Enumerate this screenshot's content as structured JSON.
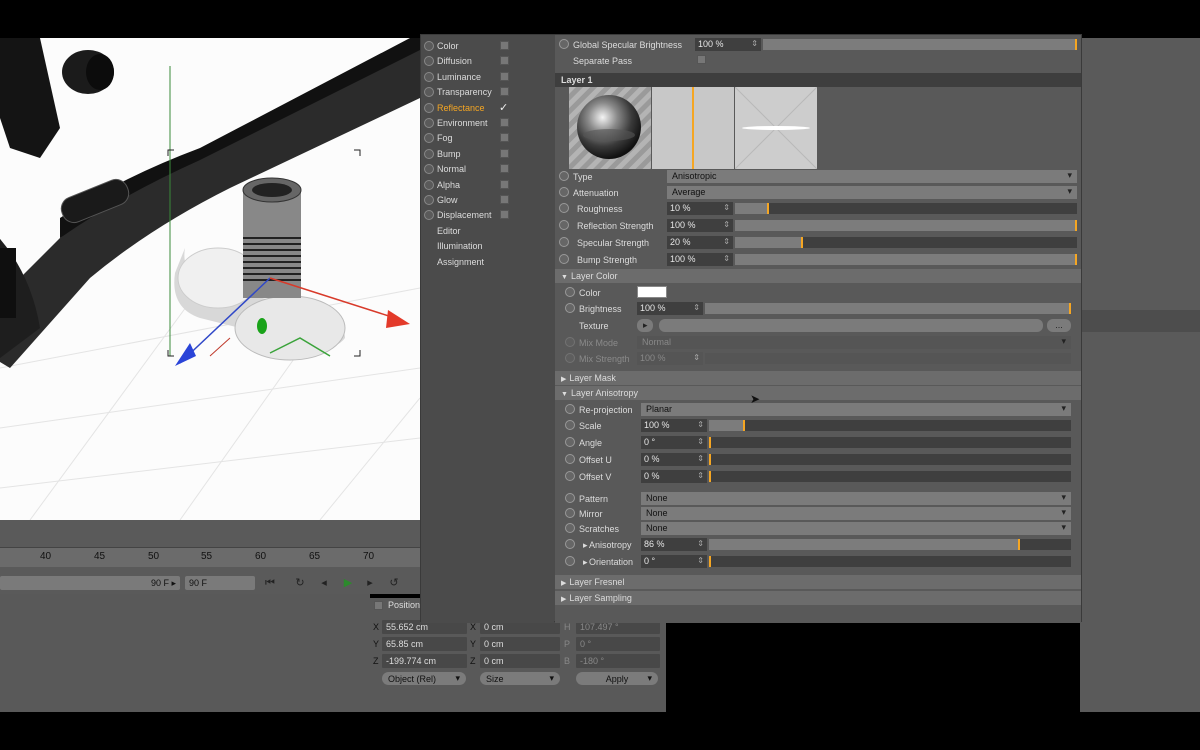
{
  "channels": [
    {
      "label": "Color",
      "checked": false
    },
    {
      "label": "Diffusion",
      "checked": false
    },
    {
      "label": "Luminance",
      "checked": false
    },
    {
      "label": "Transparency",
      "checked": false
    },
    {
      "label": "Reflectance",
      "checked": true,
      "active": true
    },
    {
      "label": "Environment",
      "checked": false
    },
    {
      "label": "Fog",
      "checked": false
    },
    {
      "label": "Bump",
      "checked": false
    },
    {
      "label": "Normal",
      "checked": false
    },
    {
      "label": "Alpha",
      "checked": false
    },
    {
      "label": "Glow",
      "checked": false
    },
    {
      "label": "Displacement",
      "checked": false
    },
    {
      "label": "Editor"
    },
    {
      "label": "Illumination"
    },
    {
      "label": "Assignment"
    }
  ],
  "global": {
    "spec_label": "Global Specular Brightness",
    "spec_value": "100 %",
    "spec_level": 1.0,
    "separate_pass_label": "Separate Pass"
  },
  "layer": {
    "title": "Layer 1",
    "type_label": "Type",
    "type_value": "Anisotropic",
    "attenuation_label": "Attenuation",
    "attenuation_value": "Average",
    "roughness_label": "Roughness",
    "roughness_value": "10 %",
    "roughness_level": 0.1,
    "refl_label": "Reflection Strength",
    "refl_value": "100 %",
    "refl_level": 1.0,
    "spec_label": "Specular Strength",
    "spec_value": "20 %",
    "spec_level": 0.2,
    "bump_label": "Bump Strength",
    "bump_value": "100 %",
    "bump_level": 1.0
  },
  "layer_color": {
    "title": "Layer Color",
    "color_label": "Color",
    "color_hex": "#ffffff",
    "brightness_label": "Brightness",
    "brightness_value": "100 %",
    "brightness_level": 1.0,
    "texture_label": "Texture",
    "texture_button": "...",
    "mix_mode_label": "Mix Mode",
    "mix_mode_value": "Normal",
    "mix_strength_label": "Mix Strength",
    "mix_strength_value": "100 %"
  },
  "layer_mask": {
    "title": "Layer Mask"
  },
  "layer_aniso": {
    "title": "Layer Anisotropy",
    "reprojection_label": "Re-projection",
    "reprojection_value": "Planar",
    "scale_label": "Scale",
    "scale_value": "100 %",
    "scale_level": 0.1,
    "angle_label": "Angle",
    "angle_value": "0 °",
    "offset_u_label": "Offset U",
    "offset_u_value": "0 %",
    "offset_v_label": "Offset V",
    "offset_v_value": "0 %",
    "pattern_label": "Pattern",
    "pattern_value": "None",
    "mirror_label": "Mirror",
    "mirror_value": "None",
    "scratches_label": "Scratches",
    "scratches_value": "None",
    "anisotropy_label": "Anisotropy",
    "anisotropy_value": "86 %",
    "anisotropy_level": 0.86,
    "orientation_label": "Orientation",
    "orientation_value": "0 °"
  },
  "layer_fresnel": {
    "title": "Layer Fresnel"
  },
  "layer_sampling": {
    "title": "Layer Sampling"
  },
  "timeline": {
    "ticks": [
      "40",
      "45",
      "50",
      "55",
      "60",
      "65",
      "70"
    ],
    "end_frame": "90 F",
    "end_frame_field": "90 F"
  },
  "coords": {
    "header": "Position",
    "rows": [
      {
        "axis": "X",
        "pos": "55.652 cm",
        "axis2": "X",
        "size": "0 cm",
        "rotlbl": "H",
        "rot": "107.497 °"
      },
      {
        "axis": "Y",
        "pos": "65.85 cm",
        "axis2": "Y",
        "size": "0 cm",
        "rotlbl": "P",
        "rot": "0 °"
      },
      {
        "axis": "Z",
        "pos": "-199.774 cm",
        "axis2": "Z",
        "size": "0 cm",
        "rotlbl": "B",
        "rot": "-180 °"
      }
    ],
    "mode_dropdown": "Object (Rel)",
    "size_dropdown": "Size",
    "apply": "Apply"
  },
  "colors": {
    "accent": "#f5a623"
  }
}
